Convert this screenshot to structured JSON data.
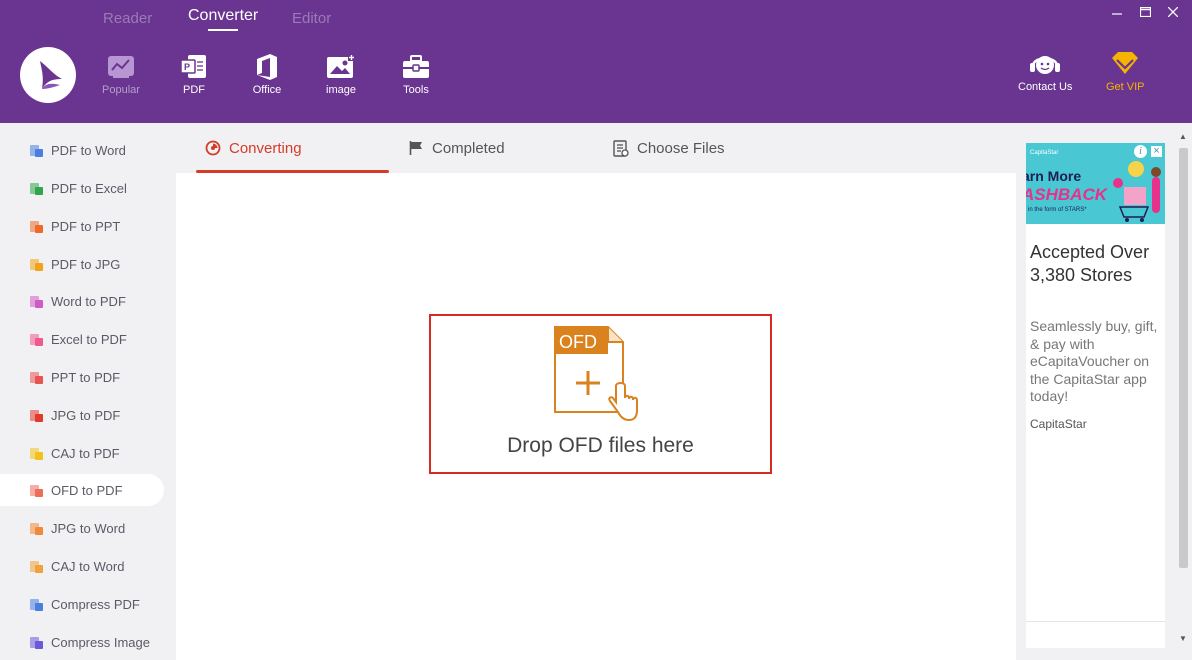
{
  "header": {
    "top_tabs": [
      "Reader",
      "Converter",
      "Editor"
    ],
    "active_top_tab": "Converter",
    "tools": [
      {
        "label": "Popular",
        "icon": "chart-icon"
      },
      {
        "label": "PDF",
        "icon": "pdf-icon"
      },
      {
        "label": "Office",
        "icon": "office-icon"
      },
      {
        "label": "image",
        "icon": "image-icon"
      },
      {
        "label": "Tools",
        "icon": "toolbox-icon"
      }
    ],
    "contact_label": "Contact Us",
    "vip_label": "Get VIP"
  },
  "sidebar": {
    "items": [
      {
        "label": "PDF to Word",
        "color": "#4a7fe0"
      },
      {
        "label": "PDF to Excel",
        "color": "#2fa64b"
      },
      {
        "label": "PDF to PPT",
        "color": "#ee6a2a"
      },
      {
        "label": "PDF to JPG",
        "color": "#f2a31c"
      },
      {
        "label": "Word to PDF",
        "color": "#d25ac6"
      },
      {
        "label": "Excel to PDF",
        "color": "#ef5a8c"
      },
      {
        "label": "PPT to PDF",
        "color": "#e85450"
      },
      {
        "label": "JPG to PDF",
        "color": "#e23b2e"
      },
      {
        "label": "CAJ to PDF",
        "color": "#f2c21c"
      },
      {
        "label": "OFD to PDF",
        "color": "#ee6c5a"
      },
      {
        "label": "JPG to Word",
        "color": "#f08a3a"
      },
      {
        "label": "CAJ to Word",
        "color": "#f0a33a"
      },
      {
        "label": "Compress PDF",
        "color": "#4a7fe0"
      },
      {
        "label": "Compress Image",
        "color": "#6b5ad8"
      }
    ],
    "active_item": "OFD to PDF"
  },
  "main": {
    "tabs": [
      {
        "label": "Converting",
        "icon": "converting-icon"
      },
      {
        "label": "Completed",
        "icon": "flag-icon"
      },
      {
        "label": "Choose Files",
        "icon": "file-list-icon"
      }
    ],
    "active_tab": "Converting",
    "drop_zone": {
      "badge": "OFD",
      "text": "Drop OFD files here"
    }
  },
  "ad": {
    "brand_small": "CapitaStar",
    "headline_line1": "arn More",
    "headline_line2": "ASHBACK",
    "fine_print": "in the form of STARS*",
    "title": "Accepted Over 3,380 Stores",
    "description": "Seamlessly buy, gift, & pay with eCapitaVoucher on the CapitaStar app today!",
    "advertiser": "CapitaStar"
  },
  "colors": {
    "header_bg": "#6a3591",
    "accent_red": "#d43c2a",
    "ofd_orange": "#d9821e",
    "vip_gold": "#f5b400"
  }
}
